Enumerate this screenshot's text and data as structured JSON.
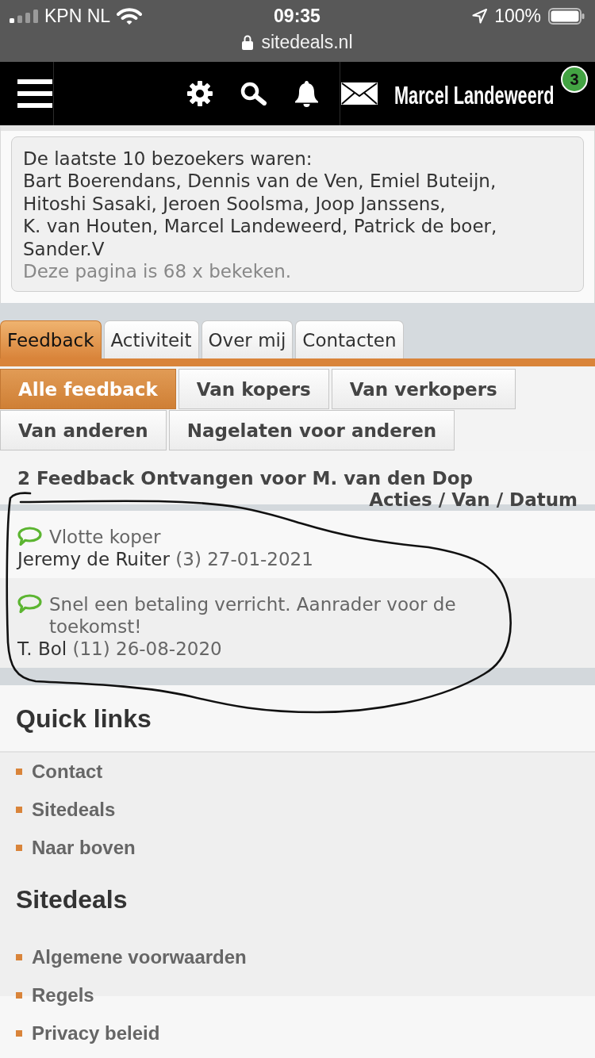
{
  "status_bar": {
    "carrier": "KPN NL",
    "time": "09:35",
    "battery": "100%",
    "url": "sitedeals.nl"
  },
  "nav": {
    "user_name": "Marcel Landeweerd",
    "badge": "3"
  },
  "visitors": {
    "intro": "De laatste 10 bezoekers waren:",
    "names": [
      "Bart Boerendans,",
      "Dennis van de Ven,",
      "Emiel Buteijn,",
      "Hitoshi Sasaki,",
      "Jeroen Soolsma,",
      "Joop Janssens,",
      "K. van Houten,",
      "Marcel Landeweerd,",
      "Patrick de boer,",
      "Sander.V"
    ],
    "views": "Deze pagina is 68 x bekeken."
  },
  "tabs": [
    {
      "label": "Feedback",
      "selected": true
    },
    {
      "label": "Activiteit",
      "selected": false
    },
    {
      "label": "Over mij",
      "selected": false
    },
    {
      "label": "Contacten",
      "selected": false
    }
  ],
  "filters": [
    {
      "label": "Alle feedback",
      "selected": true
    },
    {
      "label": "Van kopers",
      "selected": false
    },
    {
      "label": "Van verkopers",
      "selected": false
    },
    {
      "label": "Van anderen",
      "selected": false
    },
    {
      "label": "Nagelaten voor anderen",
      "selected": false
    }
  ],
  "feedback": {
    "title": "2 Feedback Ontvangen voor M. van den Dop",
    "columns_label": "Acties / Van / Datum",
    "items": [
      {
        "comment": "Vlotte koper",
        "author": "Jeremy de Ruiter",
        "score": "(3)",
        "date": "27-01-2021"
      },
      {
        "comment": "Snel een betaling verricht. Aanrader voor de toekomst!",
        "author": "T. Bol",
        "score": "(11)",
        "date": "26-08-2020"
      }
    ]
  },
  "footer": [
    {
      "heading": "Quick links",
      "links": [
        "Contact",
        "Sitedeals",
        "Naar boven"
      ]
    },
    {
      "heading": "Sitedeals",
      "links": [
        "Algemene voorwaarden",
        "Regels",
        "Privacy beleid"
      ]
    }
  ]
}
